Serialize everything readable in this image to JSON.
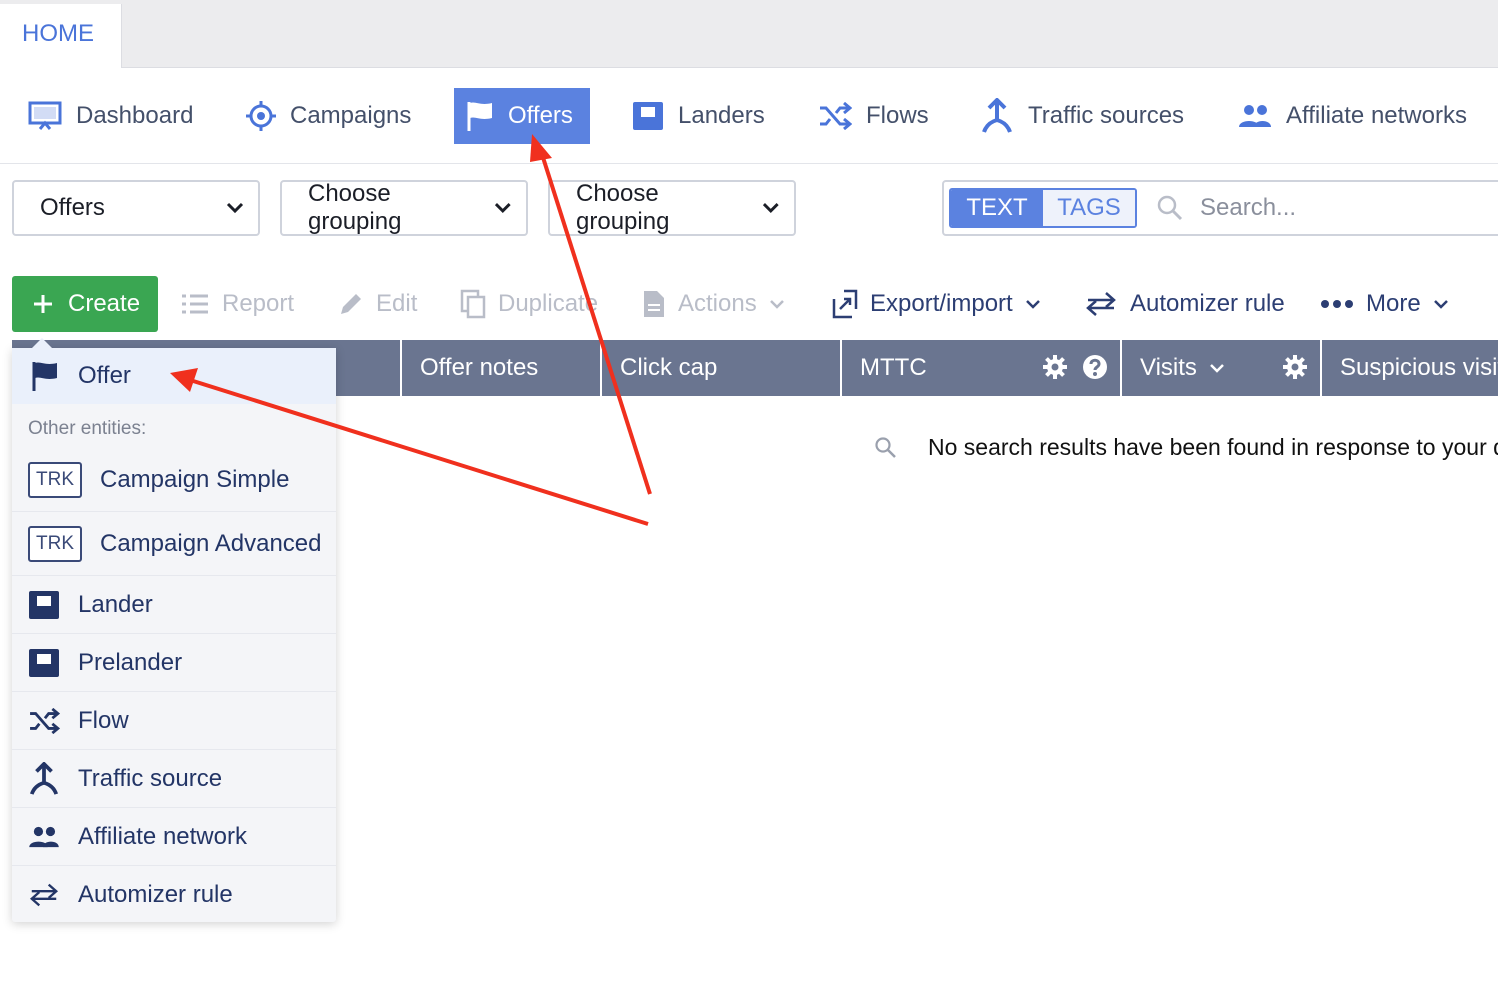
{
  "top_tabs": {
    "home": "HOME"
  },
  "nav": {
    "items": [
      {
        "label": "Dashboard",
        "icon": "monitor-icon"
      },
      {
        "label": "Campaigns",
        "icon": "target-icon"
      },
      {
        "label": "Offers",
        "icon": "flag-icon",
        "active": true
      },
      {
        "label": "Landers",
        "icon": "lander-icon"
      },
      {
        "label": "Flows",
        "icon": "shuffle-icon"
      },
      {
        "label": "Traffic sources",
        "icon": "traffic-source-icon"
      },
      {
        "label": "Affiliate networks",
        "icon": "users-icon"
      }
    ]
  },
  "filters": {
    "entity_select": "Offers",
    "grouping_1": "Choose grouping",
    "grouping_2": "Choose grouping",
    "toggle_text": "TEXT",
    "toggle_tags": "TAGS",
    "search_placeholder": "Search..."
  },
  "toolbar": {
    "create": "Create",
    "report": "Report",
    "edit": "Edit",
    "duplicate": "Duplicate",
    "actions": "Actions",
    "export_import": "Export/import",
    "automizer_rule": "Automizer rule",
    "more": "More"
  },
  "table": {
    "columns": [
      "Offer notes",
      "Click cap",
      "MTTC",
      "Visits",
      "Suspicious visits"
    ],
    "empty_message": "No search results have been found in response to your query"
  },
  "create_menu": {
    "primary": "Offer",
    "section_label": "Other entities:",
    "trk_badge": "TRK",
    "items": [
      {
        "label": "Campaign Simple",
        "icon": "trk-badge"
      },
      {
        "label": "Campaign Advanced",
        "icon": "trk-badge"
      },
      {
        "label": "Lander",
        "icon": "lander-icon"
      },
      {
        "label": "Prelander",
        "icon": "lander-icon"
      },
      {
        "label": "Flow",
        "icon": "shuffle-icon"
      },
      {
        "label": "Traffic source",
        "icon": "traffic-source-icon"
      },
      {
        "label": "Affiliate network",
        "icon": "users-icon"
      },
      {
        "label": "Automizer rule",
        "icon": "swap-arrows-icon"
      }
    ]
  },
  "colors": {
    "accent": "#5b82e0",
    "create_green": "#3aa652",
    "table_header": "#6a7590",
    "annotation_arrow": "#f0301e"
  }
}
